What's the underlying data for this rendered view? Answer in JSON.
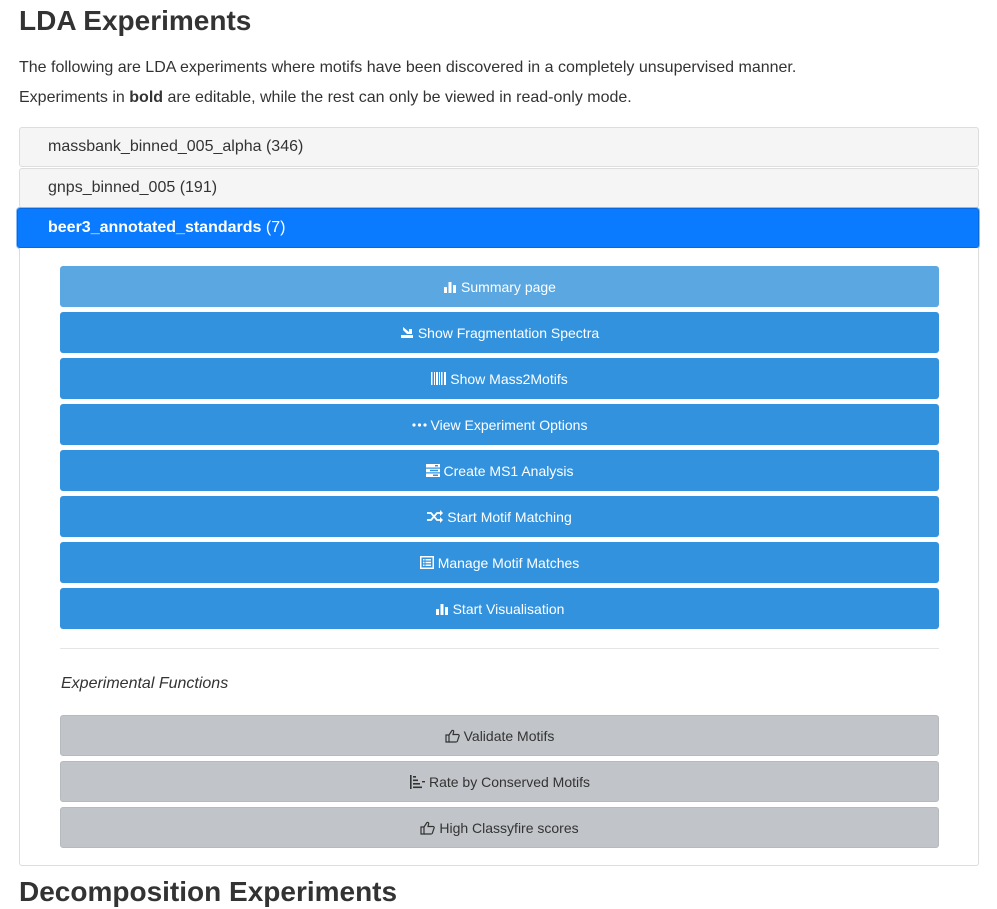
{
  "page": {
    "title": "LDA Experiments",
    "description_line1": "The following are LDA experiments where motifs have been discovered in a completely unsupervised manner.",
    "description_line2_pre": "Experiments in ",
    "description_line2_bold": "bold",
    "description_line2_post": " are editable, while the rest can only be viewed in read-only mode."
  },
  "experiments": [
    {
      "name": "massbank_binned_005_alpha",
      "count": "(346)"
    },
    {
      "name": "gnps_binned_005",
      "count": "(191)"
    },
    {
      "name": "beer3_annotated_standards",
      "count": "(7)"
    }
  ],
  "actions": {
    "summary": "Summary page",
    "fragmentation": "Show Fragmentation Spectra",
    "mass2motifs": "Show Mass2Motifs",
    "options": "View Experiment Options",
    "ms1": "Create MS1 Analysis",
    "motif_matching": "Start Motif Matching",
    "manage_matches": "Manage Motif Matches",
    "visualisation": "Start Visualisation"
  },
  "experimental": {
    "label": "Experimental Functions",
    "validate": "Validate Motifs",
    "rate": "Rate by Conserved Motifs",
    "classyfire": "High Classyfire scores"
  },
  "next_section": {
    "title": "Decomposition Experiments"
  },
  "colors": {
    "active_header": "#0a7bff",
    "primary_button": "#3292dd",
    "grey_button": "#c1c5c9"
  }
}
